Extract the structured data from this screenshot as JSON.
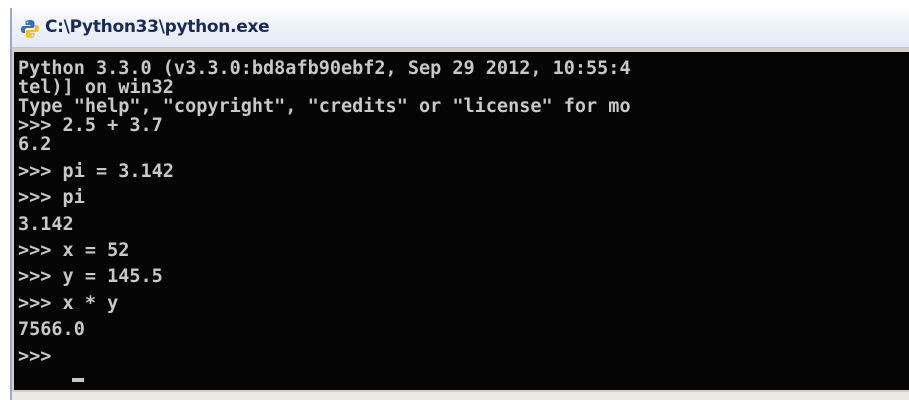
{
  "window": {
    "title": "C:\\Python33\\python.exe",
    "icon": "python-icon"
  },
  "console": {
    "lines": [
      "Python 3.3.0 (v3.3.0:bd8afb90ebf2, Sep 29 2012, 10:55:4",
      "tel)] on win32",
      "Type \"help\", \"copyright\", \"credits\" or \"license\" for mo",
      ">>> 2.5 + 3.7",
      "6.2",
      ">>> pi = 3.142",
      ">>> pi",
      "3.142",
      ">>> x = 52",
      ">>> y = 145.5",
      ">>> x * y",
      "7566.0",
      ">>> "
    ]
  },
  "colors": {
    "console_background": "#050505",
    "console_text": "#c8c8c8",
    "title_text": "#1a2a55"
  }
}
